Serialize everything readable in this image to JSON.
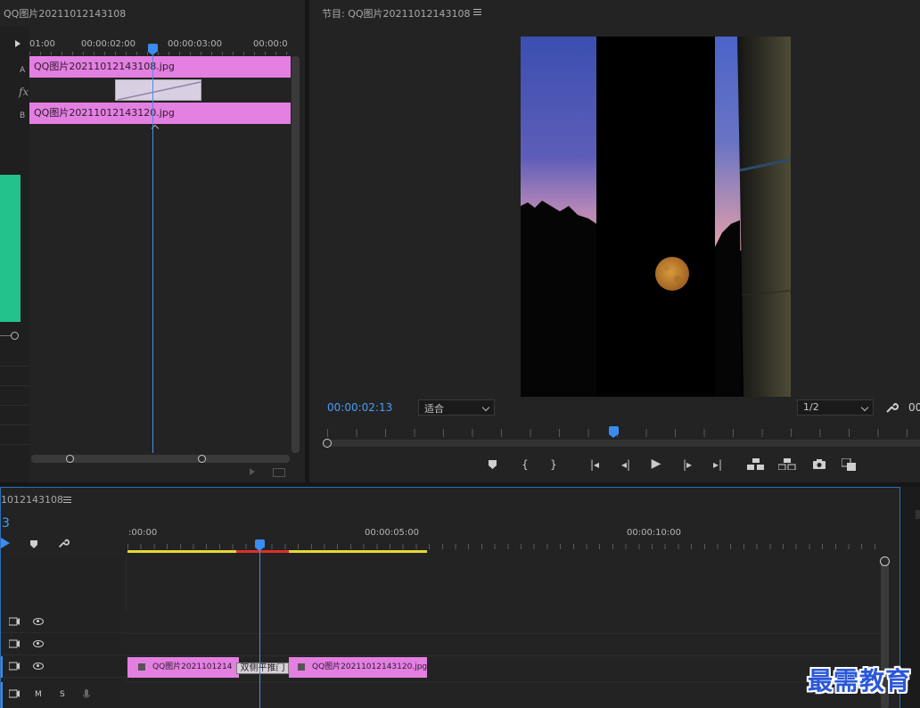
{
  "source_panel": {
    "title": "QQ图片20211012143108",
    "ruler_labels": [
      "01:00",
      "00:00:02:00",
      "00:00:03:00",
      "00:00:0"
    ],
    "track_a_label": "A",
    "track_b_label": "B",
    "fx_label": "fx",
    "clip_a": "QQ图片20211012143108.jpg",
    "clip_b": "QQ图片20211012143120.jpg"
  },
  "program_monitor": {
    "title": "节目: QQ图片20211012143108",
    "timecode": "00:00:02:13",
    "fit_label": "适合",
    "resolution_label": "1/2",
    "right_cut_text": "00"
  },
  "timeline": {
    "title": "1012143108",
    "timecode_partial": "3",
    "ruler_labels": [
      ":00:00",
      "00:00:05:00",
      "00:00:10:00"
    ],
    "video_clip_1": "QQ图片2021101214",
    "transition_label": "双侧平推门",
    "video_clip_2": "QQ图片20211012143120.jpg",
    "audio_m": "M",
    "audio_s": "S"
  },
  "watermark": "最需教育",
  "colors": {
    "accent_blue": "#3b8cf0",
    "clip_pink": "#e47fe2",
    "work_area_yellow": "#e5d83a",
    "render_red": "#d9322b",
    "green_panel": "#23c28d"
  }
}
